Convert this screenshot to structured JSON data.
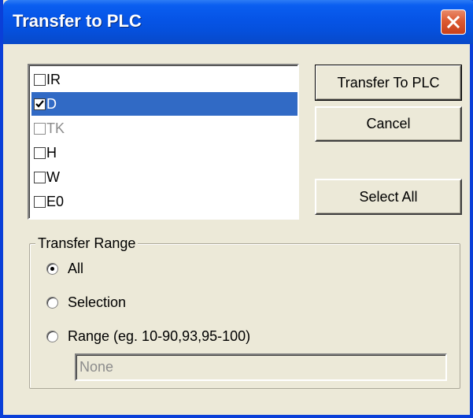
{
  "window": {
    "title": "Transfer to PLC"
  },
  "list": {
    "items": [
      {
        "label": "IR",
        "checked": false,
        "selected": false,
        "disabled": false
      },
      {
        "label": "D",
        "checked": true,
        "selected": true,
        "disabled": false
      },
      {
        "label": "TK",
        "checked": false,
        "selected": false,
        "disabled": true
      },
      {
        "label": "H",
        "checked": false,
        "selected": false,
        "disabled": false
      },
      {
        "label": "W",
        "checked": false,
        "selected": false,
        "disabled": false
      },
      {
        "label": "E0",
        "checked": false,
        "selected": false,
        "disabled": false
      }
    ]
  },
  "buttons": {
    "transfer": "Transfer To PLC",
    "cancel": "Cancel",
    "select_all": "Select All"
  },
  "transfer_range": {
    "label": "Transfer Range",
    "options": [
      {
        "label": "All",
        "selected": true
      },
      {
        "label": "Selection",
        "selected": false
      },
      {
        "label": "Range (eg. 10-90,93,95-100)",
        "selected": false
      }
    ],
    "range_value": "None"
  },
  "colors": {
    "titlebar": "#0a5ef0",
    "selection": "#316ac5",
    "close": "#dc5a32",
    "dialog_bg": "#ece9d8"
  }
}
